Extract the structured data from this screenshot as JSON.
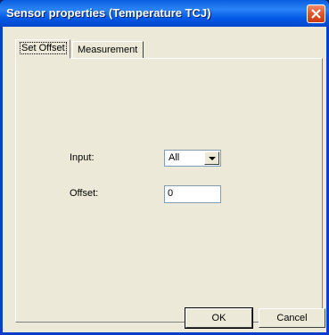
{
  "window": {
    "title": "Sensor properties (Temperature TCJ)",
    "close_icon": "close-icon"
  },
  "tabs": [
    {
      "label": "Set Offset",
      "active": true
    },
    {
      "label": "Measurement",
      "active": false
    }
  ],
  "form": {
    "input_label": "Input:",
    "input_value": "All",
    "offset_label": "Offset:",
    "offset_value": "0"
  },
  "buttons": {
    "ok_label": "OK",
    "cancel_label": "Cancel"
  },
  "colors": {
    "titlebar": "#0058e6",
    "close_button": "#e2542a",
    "dialog_face": "#ece9d8"
  }
}
